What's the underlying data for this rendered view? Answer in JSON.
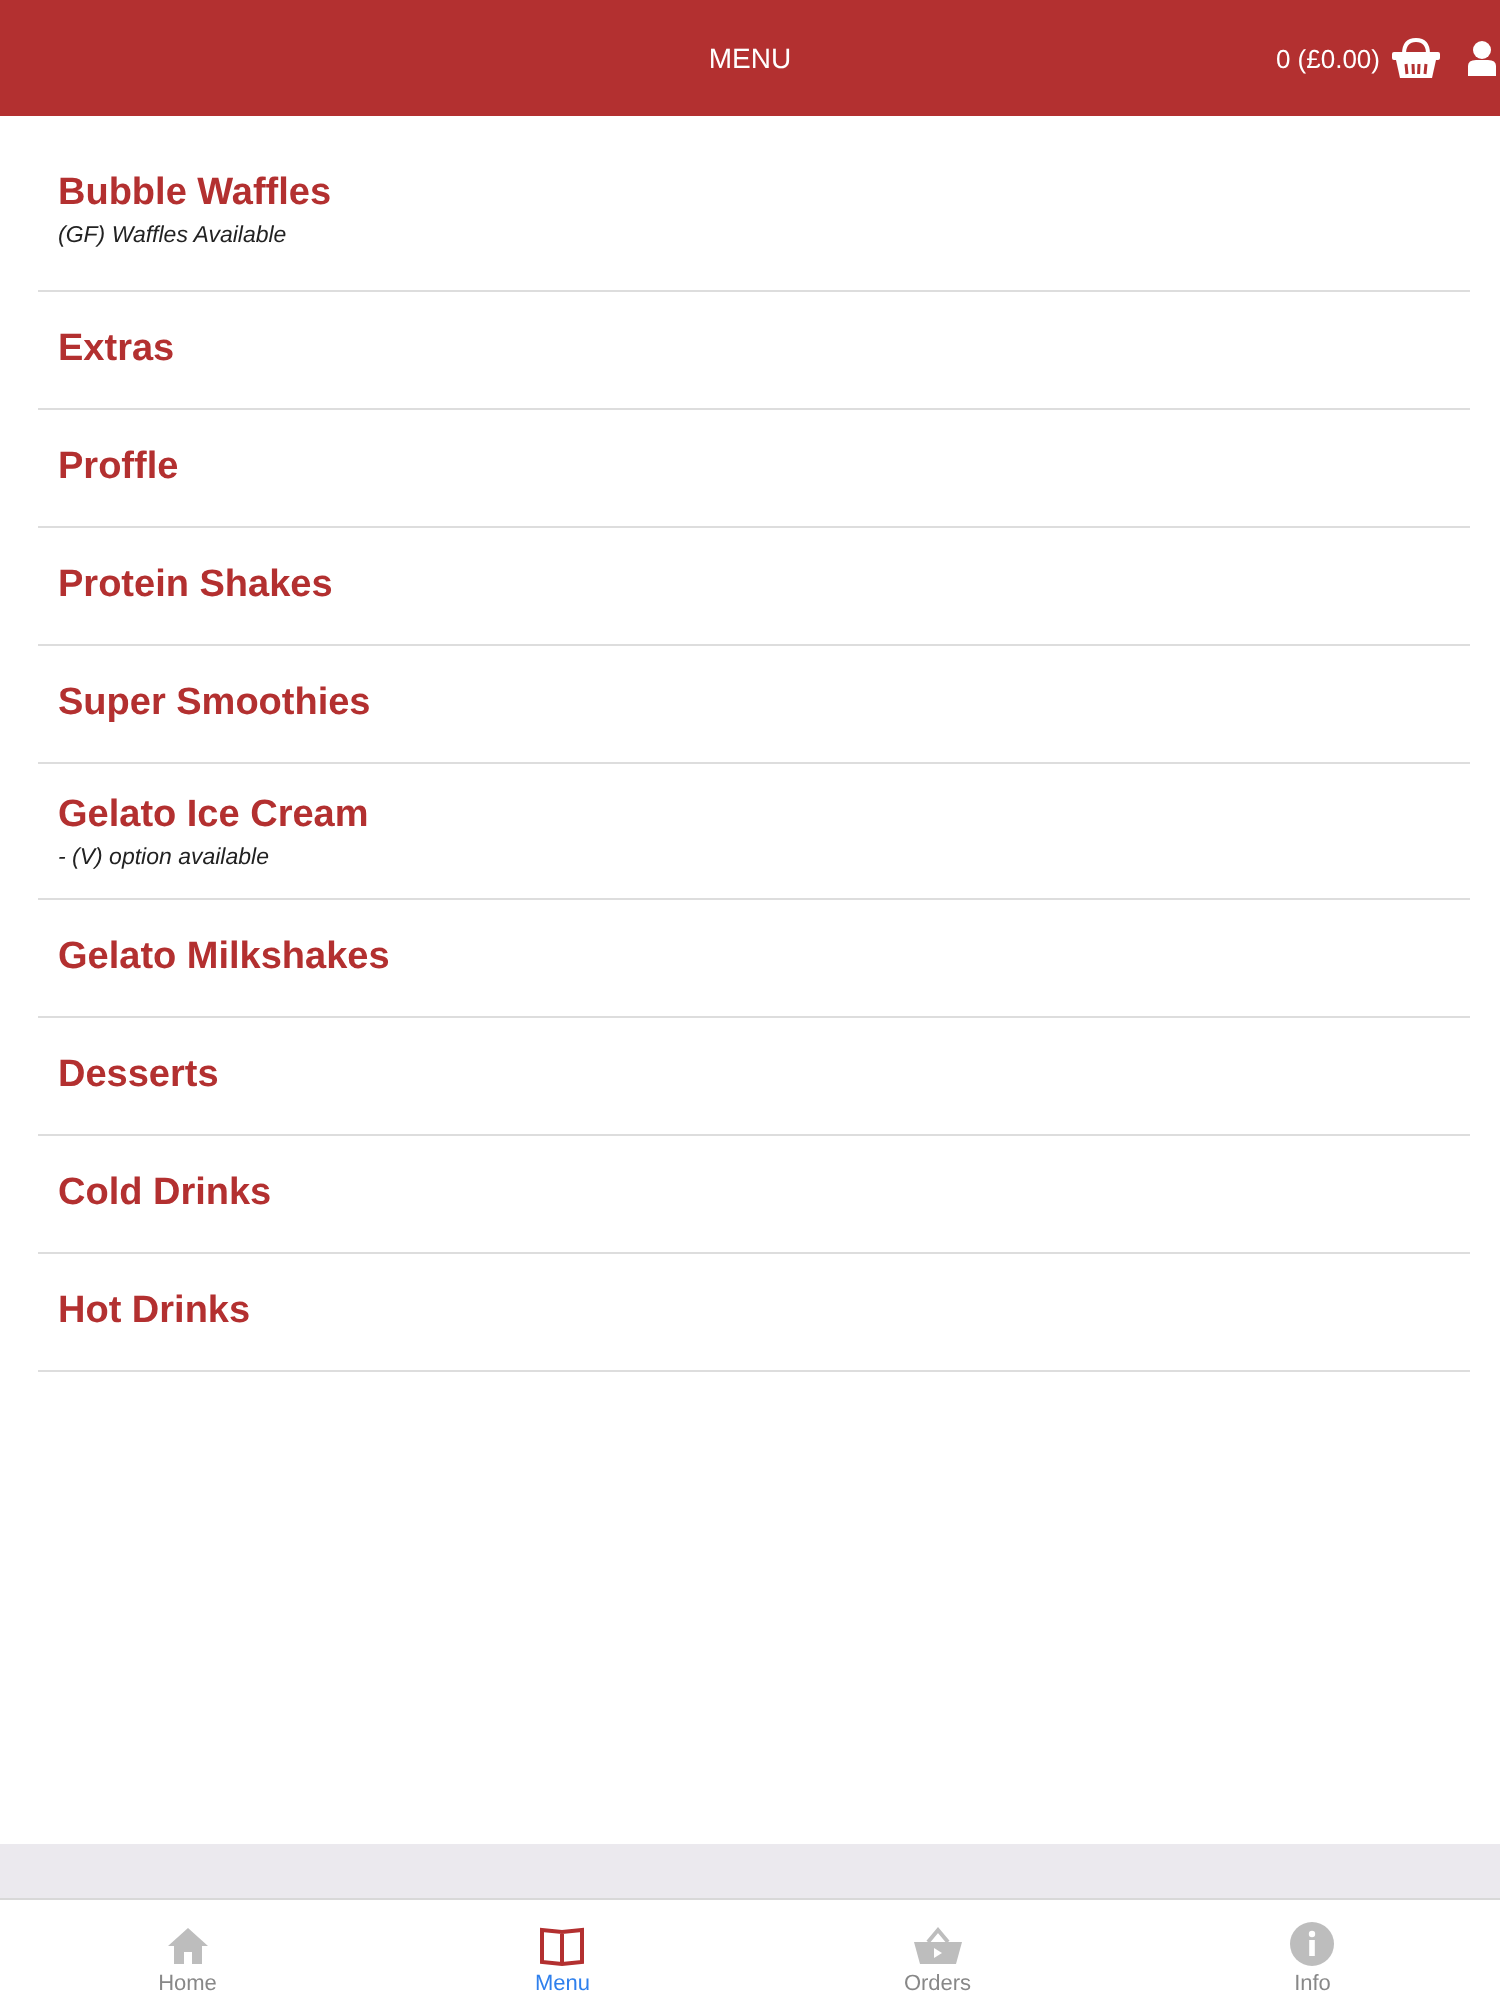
{
  "header": {
    "title": "MENU",
    "cart": "0 (£0.00)"
  },
  "categories": [
    {
      "name": "Bubble Waffles",
      "note": "(GF) Waffles Available"
    },
    {
      "name": "Extras"
    },
    {
      "name": "Proffle"
    },
    {
      "name": "Protein Shakes"
    },
    {
      "name": "Super Smoothies"
    },
    {
      "name": "Gelato Ice Cream",
      "note": "- (V) option available"
    },
    {
      "name": "Gelato Milkshakes"
    },
    {
      "name": "Desserts"
    },
    {
      "name": "Cold Drinks"
    },
    {
      "name": "Hot Drinks"
    }
  ],
  "tabs": [
    {
      "label": "Home",
      "kind": "home",
      "selected": false
    },
    {
      "label": "Menu",
      "kind": "book",
      "selected": true
    },
    {
      "label": "Orders",
      "kind": "basket",
      "selected": false
    },
    {
      "label": "Info",
      "kind": "info",
      "selected": false
    }
  ]
}
